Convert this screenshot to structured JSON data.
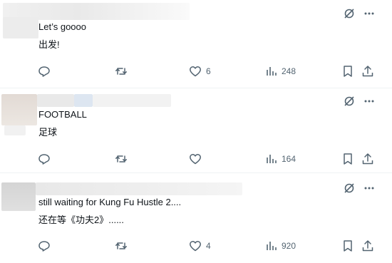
{
  "posts": [
    {
      "text_en": "Let’s goooo",
      "text_zh": "出发!",
      "likes": "6",
      "views": "248"
    },
    {
      "text_en": "FOOTBALL",
      "text_zh": "足球",
      "likes": "",
      "views": "164"
    },
    {
      "text_en": "still waiting for Kung Fu Hustle 2....",
      "text_zh": "还在等《功夫2》......",
      "likes": "4",
      "views": "920"
    }
  ],
  "icons": {
    "translate": "translate-icon",
    "more": "more-icon",
    "reply": "reply-icon",
    "repost": "repost-icon",
    "like": "like-icon",
    "views": "views-icon",
    "bookmark": "bookmark-icon",
    "share": "share-icon"
  },
  "colors": {
    "text": "#0f1419",
    "muted": "#536471",
    "divider": "#eff3f4"
  }
}
